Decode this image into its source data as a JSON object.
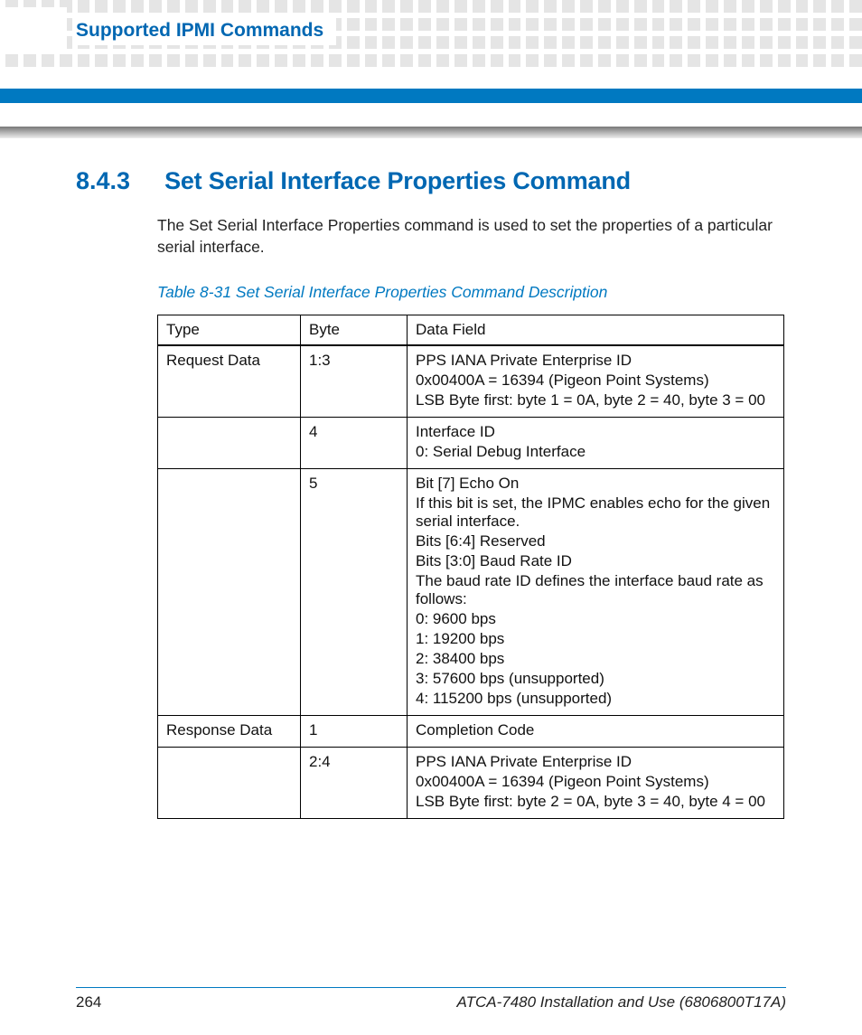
{
  "chapter_title": "Supported IPMI Commands",
  "section": {
    "number": "8.4.3",
    "title": "Set Serial Interface Properties Command",
    "body": "The Set Serial Interface Properties command is used to set the properties of a particular serial interface."
  },
  "table": {
    "caption": "Table 8-31 Set Serial Interface Properties Command Description",
    "headers": [
      "Type",
      "Byte",
      "Data Field"
    ],
    "rows": [
      {
        "type": "Request Data",
        "byte": "1:3",
        "data": [
          "PPS IANA Private Enterprise ID",
          "0x00400A = 16394 (Pigeon Point Systems)",
          "LSB Byte first: byte 1 = 0A, byte 2 = 40, byte 3 = 00"
        ]
      },
      {
        "type": "",
        "byte": "4",
        "data": [
          "Interface ID",
          "0: Serial Debug Interface"
        ]
      },
      {
        "type": "",
        "byte": "5",
        "data": [
          "Bit [7] Echo On",
          "If this bit is set, the IPMC enables echo for the given serial interface.",
          "Bits [6:4] Reserved",
          "Bits [3:0] Baud Rate ID",
          "The baud rate ID defines the interface baud rate as follows:",
          "0: 9600 bps",
          "1: 19200 bps",
          "2: 38400 bps",
          "3: 57600 bps (unsupported)",
          "4: 115200 bps (unsupported)"
        ]
      },
      {
        "type": "Response Data",
        "byte": "1",
        "data": [
          "Completion Code"
        ]
      },
      {
        "type": "",
        "byte": "2:4",
        "data": [
          "PPS IANA Private Enterprise ID",
          "0x00400A = 16394 (Pigeon Point Systems)",
          "LSB Byte first: byte 2 = 0A, byte 3 = 40, byte 4 = 00"
        ]
      }
    ]
  },
  "footer": {
    "page": "264",
    "doc": "ATCA-7480 Installation and Use (6806800T17A)"
  }
}
